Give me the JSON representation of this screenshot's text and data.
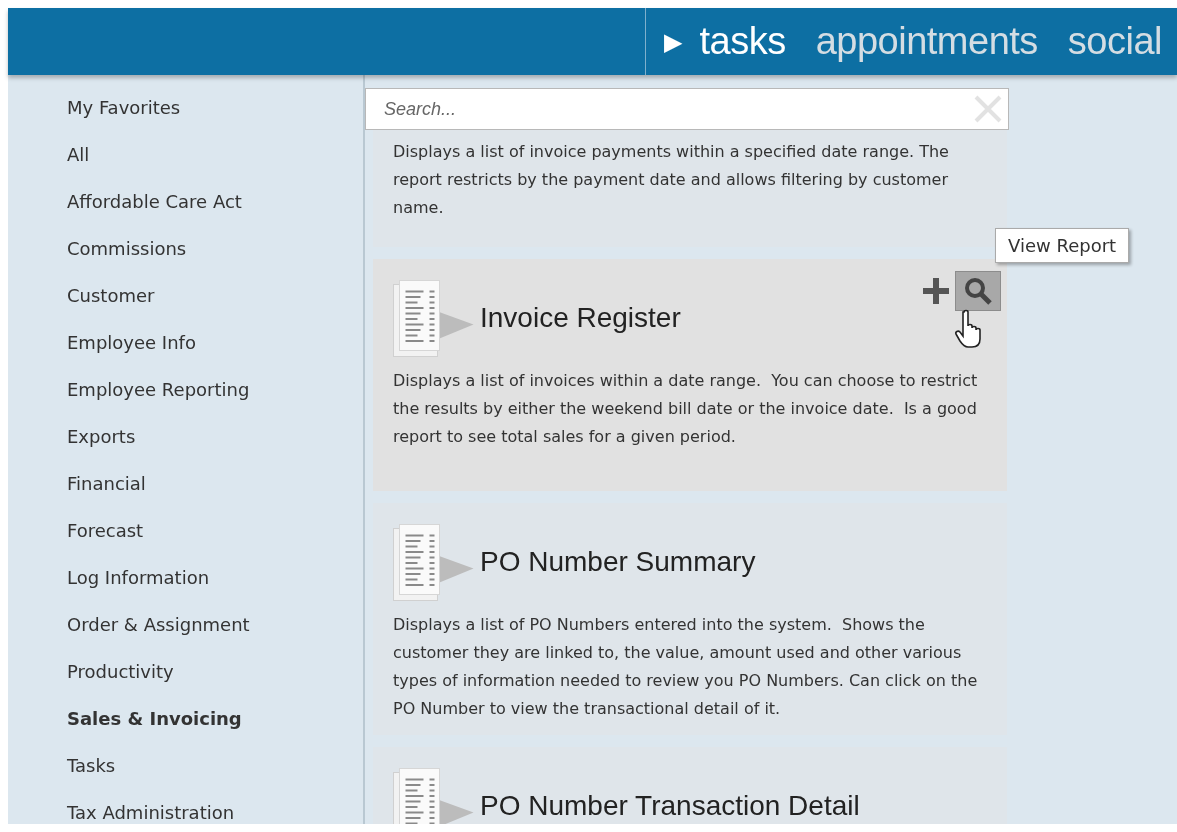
{
  "top_nav": {
    "items": [
      {
        "label": "tasks",
        "selected": true
      },
      {
        "label": "appointments",
        "selected": false
      },
      {
        "label": "social",
        "selected": false
      }
    ],
    "marker": "▶"
  },
  "sidebar": {
    "items": [
      {
        "label": "My Favorites",
        "selected": false
      },
      {
        "label": "All",
        "selected": false
      },
      {
        "label": "Affordable Care Act",
        "selected": false
      },
      {
        "label": "Commissions",
        "selected": false
      },
      {
        "label": "Customer",
        "selected": false
      },
      {
        "label": "Employee Info",
        "selected": false
      },
      {
        "label": "Employee Reporting",
        "selected": false
      },
      {
        "label": "Exports",
        "selected": false
      },
      {
        "label": "Financial",
        "selected": false
      },
      {
        "label": "Forecast",
        "selected": false
      },
      {
        "label": "Log Information",
        "selected": false
      },
      {
        "label": "Order & Assignment",
        "selected": false
      },
      {
        "label": "Productivity",
        "selected": false
      },
      {
        "label": "Sales & Invoicing",
        "selected": true
      },
      {
        "label": "Tasks",
        "selected": false
      },
      {
        "label": "Tax Administration",
        "selected": false
      }
    ]
  },
  "search": {
    "placeholder": "Search..."
  },
  "reports": [
    {
      "kind": "partial",
      "description": "Displays a list of invoice payments within a specified date range. The report restricts by the payment date and allows filtering by customer name."
    },
    {
      "kind": "full",
      "title": "Invoice Register",
      "description": "Displays a list of invoices within a date range.  You can choose to restrict the results by either the weekend bill date or the invoice date.  Is a good report to see total sales for a given period.",
      "hovered": true
    },
    {
      "kind": "full",
      "title": "PO Number Summary",
      "description": "Displays a list of PO Numbers entered into the system.  Shows the customer they are linked to, the value, amount used and other various types of information needed to review you PO Numbers. Can click on the PO Number to view the transactional detail of it.",
      "hovered": false
    },
    {
      "kind": "full",
      "title": "PO Number Transaction Detail",
      "hovered": false
    }
  ],
  "tooltip": {
    "text": "View Report"
  }
}
